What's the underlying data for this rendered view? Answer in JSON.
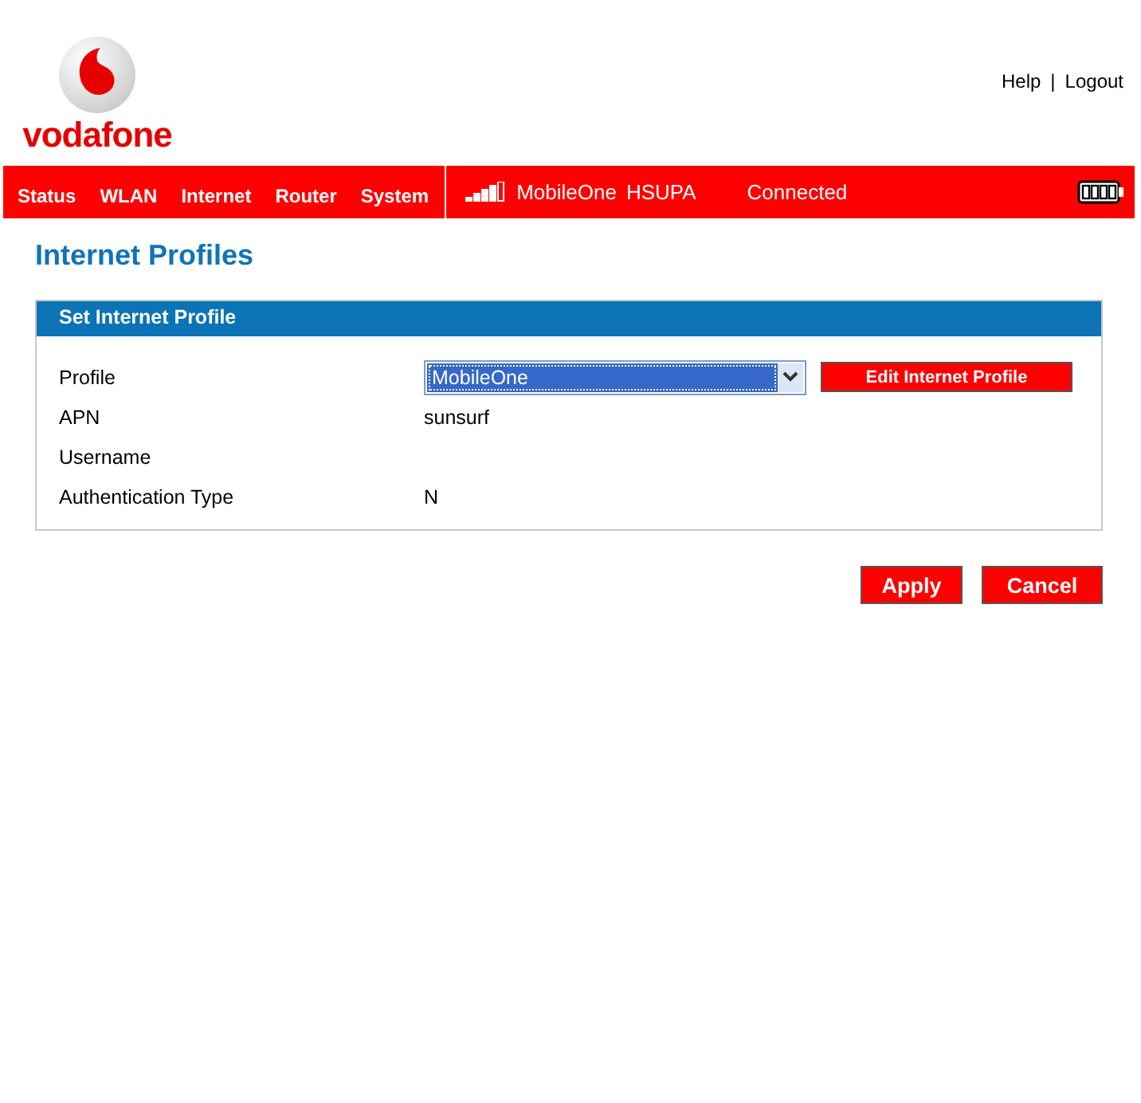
{
  "header": {
    "logo_text": "vodafone",
    "links": [
      {
        "label": "Help"
      },
      {
        "label": "Logout"
      }
    ],
    "separator": "|"
  },
  "nav": {
    "items": [
      {
        "label": "Status"
      },
      {
        "label": "WLAN"
      },
      {
        "label": "Internet"
      },
      {
        "label": "Router"
      },
      {
        "label": "System"
      }
    ],
    "operator": "MobileOne",
    "network": "HSUPA",
    "connection": "Connected"
  },
  "page_title": "Internet Profiles",
  "panel": {
    "title": "Set Internet Profile",
    "rows": [
      {
        "kind": "select",
        "label": "Profile",
        "value": "MobileOne",
        "button": "Edit Internet Profile"
      },
      {
        "kind": "text",
        "label": "APN",
        "value": "sunsurf"
      },
      {
        "kind": "text",
        "label": "Username"
      },
      {
        "kind": "text",
        "label": "Authentication Type",
        "value": "N"
      }
    ]
  },
  "buttons": [
    "Apply",
    "Cancel"
  ]
}
